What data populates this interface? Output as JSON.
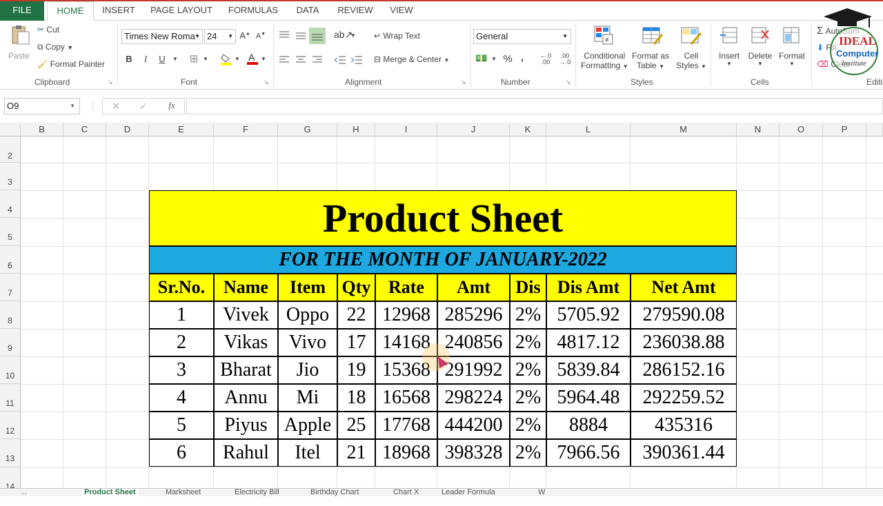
{
  "tabs": [
    "FILE",
    "HOME",
    "INSERT",
    "PAGE LAYOUT",
    "FORMULAS",
    "DATA",
    "REVIEW",
    "VIEW"
  ],
  "ribbon": {
    "paste": "Paste",
    "cut": "Cut",
    "copy": "Copy",
    "format_painter": "Format Painter",
    "clipboard": "Clipboard",
    "font_name": "Times New Roma",
    "font_size": "24",
    "font": "Font",
    "wrap_text": "Wrap Text",
    "merge_center": "Merge & Center",
    "alignment": "Alignment",
    "number_format": "General",
    "number": "Number",
    "conditional_formatting_1": "Conditional",
    "conditional_formatting_2": "Formatting",
    "format_as_table_1": "Format as",
    "format_as_table_2": "Table",
    "cell_styles_1": "Cell",
    "cell_styles_2": "Styles",
    "styles": "Styles",
    "insert": "Insert",
    "delete": "Delete",
    "format": "Format",
    "cells": "Cells",
    "autosum": "AutoSum",
    "fill": "Fill",
    "clear": "Clear",
    "editing": "Editi"
  },
  "logo": {
    "line1": "IDEAL",
    "line2": "Computer",
    "line3": "Institute"
  },
  "formula_bar": {
    "name_box": "O9",
    "fx": "fx",
    "value": ""
  },
  "columns": [
    "B",
    "C",
    "D",
    "E",
    "F",
    "G",
    "H",
    "I",
    "J",
    "K",
    "L",
    "M",
    "N",
    "O",
    "P"
  ],
  "rows": [
    "2",
    "3",
    "4",
    "5",
    "6",
    "7",
    "8",
    "9",
    "10",
    "11",
    "12",
    "13",
    "14"
  ],
  "sheet": {
    "title": "Product Sheet",
    "subtitle": "FOR THE MONTH OF JANUARY-2022",
    "headers": [
      "Sr.No.",
      "Name",
      "Item",
      "Qty",
      "Rate",
      "Amt",
      "Dis",
      "Dis Amt",
      "Net Amt"
    ],
    "rows": [
      [
        "1",
        "Vivek",
        "Oppo",
        "22",
        "12968",
        "285296",
        "2%",
        "5705.92",
        "279590.08"
      ],
      [
        "2",
        "Vikas",
        "Vivo",
        "17",
        "14168",
        "240856",
        "2%",
        "4817.12",
        "236038.88"
      ],
      [
        "3",
        "Bharat",
        "Jio",
        "19",
        "15368",
        "291992",
        "2%",
        "5839.84",
        "286152.16"
      ],
      [
        "4",
        "Annu",
        "Mi",
        "18",
        "16568",
        "298224",
        "2%",
        "5964.48",
        "292259.52"
      ],
      [
        "5",
        "Piyus",
        "Apple",
        "25",
        "17768",
        "444200",
        "2%",
        "8884",
        "435316"
      ],
      [
        "6",
        "Rahul",
        "Itel",
        "21",
        "18968",
        "398328",
        "2%",
        "7966.56",
        "390361.44"
      ]
    ]
  },
  "sheet_tabs": [
    "...",
    "Product Sheet",
    "Marksheet",
    "Electricity Bill",
    "Birthday Chart",
    "Chart X",
    "Leader Formula",
    "W"
  ],
  "colors": {
    "title_bg": "#ffff00",
    "subtitle_bg": "#1ea8e0",
    "header_bg": "#ffff00",
    "excel_green": "#217346"
  }
}
